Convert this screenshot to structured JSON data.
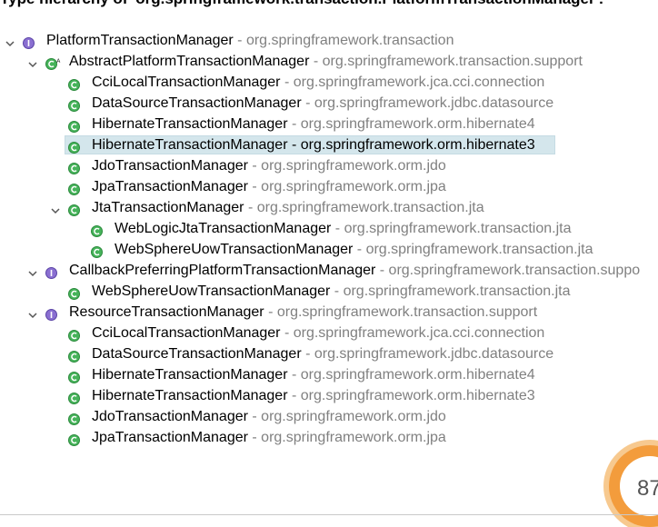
{
  "title": "Type hierarchy of 'org.springframework.transaction.PlatformTransactionManager':",
  "tree": [
    {
      "name": "PlatformTransactionManager",
      "pkg": "org.springframework.transaction",
      "kind": "interface",
      "twisty": "expanded",
      "selected": false
    },
    {
      "name": "AbstractPlatformTransactionManager",
      "pkg": "org.springframework.transaction.support",
      "kind": "abstract-class",
      "twisty": "expanded",
      "selected": false
    },
    {
      "name": "CciLocalTransactionManager",
      "pkg": "org.springframework.jca.cci.connection",
      "kind": "class",
      "twisty": "none",
      "selected": false
    },
    {
      "name": "DataSourceTransactionManager",
      "pkg": "org.springframework.jdbc.datasource",
      "kind": "class",
      "twisty": "none",
      "selected": false
    },
    {
      "name": "HibernateTransactionManager",
      "pkg": "org.springframework.orm.hibernate4",
      "kind": "class",
      "twisty": "none",
      "selected": false
    },
    {
      "name": "HibernateTransactionManager",
      "pkg": "org.springframework.orm.hibernate3",
      "kind": "class",
      "twisty": "none",
      "selected": true
    },
    {
      "name": "JdoTransactionManager",
      "pkg": "org.springframework.orm.jdo",
      "kind": "class",
      "twisty": "none",
      "selected": false
    },
    {
      "name": "JpaTransactionManager",
      "pkg": "org.springframework.orm.jpa",
      "kind": "class",
      "twisty": "none",
      "selected": false
    },
    {
      "name": "JtaTransactionManager",
      "pkg": "org.springframework.transaction.jta",
      "kind": "class",
      "twisty": "expanded",
      "selected": false
    },
    {
      "name": "WebLogicJtaTransactionManager",
      "pkg": "org.springframework.transaction.jta",
      "kind": "class",
      "twisty": "none",
      "selected": false
    },
    {
      "name": "WebSphereUowTransactionManager",
      "pkg": "org.springframework.transaction.jta",
      "kind": "class",
      "twisty": "none",
      "selected": false
    },
    {
      "name": "CallbackPreferringPlatformTransactionManager",
      "pkg": "org.springframework.transaction.suppo",
      "kind": "interface",
      "twisty": "expanded",
      "selected": false
    },
    {
      "name": "WebSphereUowTransactionManager",
      "pkg": "org.springframework.transaction.jta",
      "kind": "class",
      "twisty": "none",
      "selected": false
    },
    {
      "name": "ResourceTransactionManager",
      "pkg": "org.springframework.transaction.support",
      "kind": "interface",
      "twisty": "expanded",
      "selected": false
    },
    {
      "name": "CciLocalTransactionManager",
      "pkg": "org.springframework.jca.cci.connection",
      "kind": "class",
      "twisty": "none",
      "selected": false
    },
    {
      "name": "DataSourceTransactionManager",
      "pkg": "org.springframework.jdbc.datasource",
      "kind": "class",
      "twisty": "none",
      "selected": false
    },
    {
      "name": "HibernateTransactionManager",
      "pkg": "org.springframework.orm.hibernate4",
      "kind": "class",
      "twisty": "none",
      "selected": false
    },
    {
      "name": "HibernateTransactionManager",
      "pkg": "org.springframework.orm.hibernate3",
      "kind": "class",
      "twisty": "none",
      "selected": false
    },
    {
      "name": "JdoTransactionManager",
      "pkg": "org.springframework.orm.jdo",
      "kind": "class",
      "twisty": "none",
      "selected": false
    },
    {
      "name": "JpaTransactionManager",
      "pkg": "org.springframework.orm.jpa",
      "kind": "class",
      "twisty": "none",
      "selected": false
    }
  ],
  "separator": " - ",
  "badge": {
    "text": "87",
    "icon": "progress-ring-icon"
  },
  "colors": {
    "class_icon": "#3aa34a",
    "interface_icon": "#7b61c5",
    "package_text": "#808080",
    "selection": "#d4e6ec"
  }
}
